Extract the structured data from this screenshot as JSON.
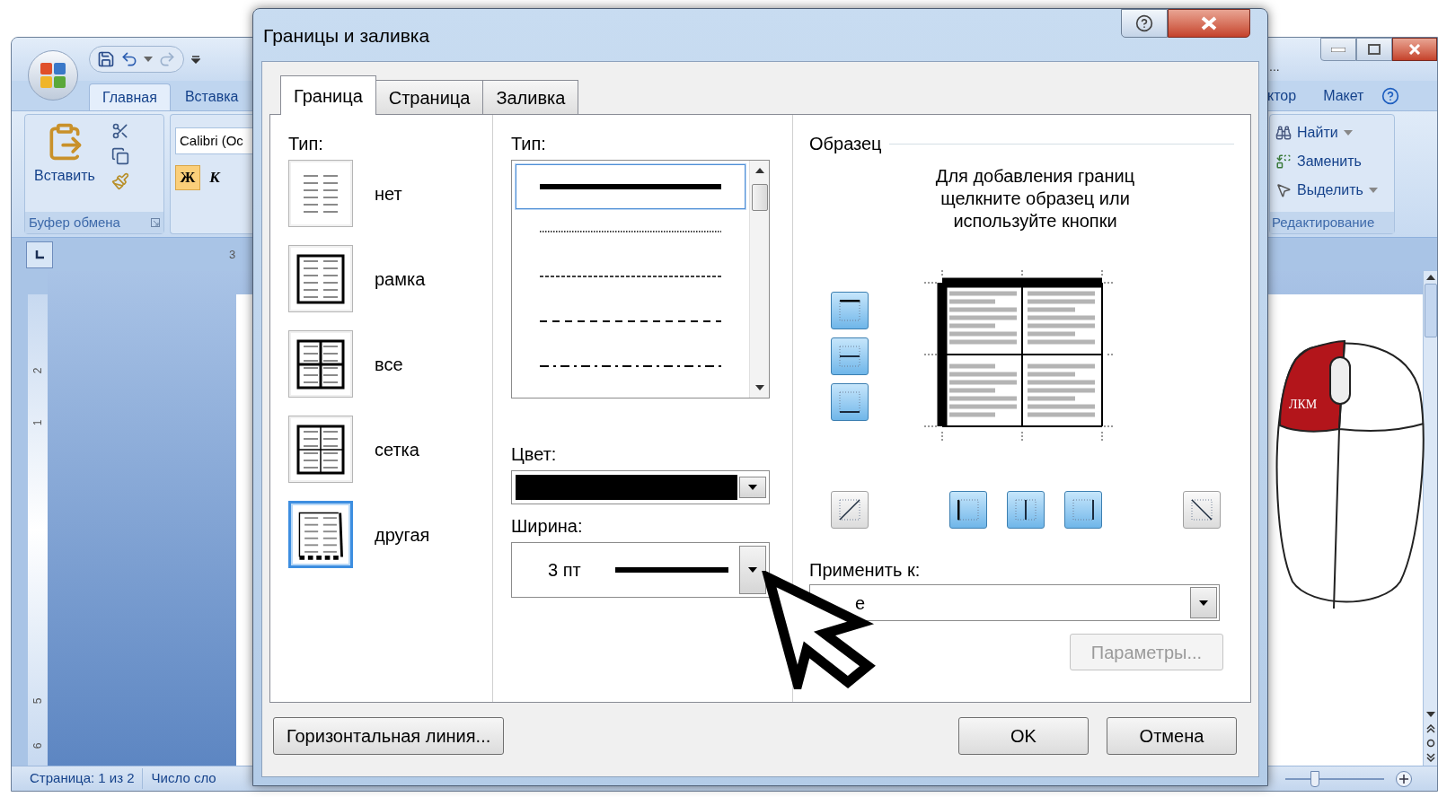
{
  "word": {
    "title_fragment": "...",
    "tabs": [
      {
        "label": "Главная",
        "selected": true
      },
      {
        "label": "Вставка",
        "selected": false
      }
    ],
    "right_tabs": [
      {
        "label": "ктор",
        "selected": false
      },
      {
        "label": "Макет",
        "selected": false
      }
    ],
    "clipboard": {
      "paste": "Вставить",
      "group": "Буфер обмена"
    },
    "font": {
      "name": "Calibri (Ос",
      "bold": "Ж",
      "italic": "К",
      "bold_active": true
    },
    "editing": {
      "items": [
        {
          "kind": "find",
          "label": "Найти",
          "dropdown": true
        },
        {
          "kind": "replace",
          "label": "Заменить",
          "dropdown": false
        },
        {
          "kind": "select",
          "label": "Выделить",
          "dropdown": true
        }
      ],
      "group": "Редактирование"
    },
    "ruler_fragment": "3",
    "vruler": [
      "2",
      "1",
      "5",
      "6"
    ],
    "status": [
      "Страница: 1 из 2",
      "Число сло"
    ],
    "zoom": {
      "level": 0.3
    }
  },
  "dialog": {
    "title": "Границы и заливка",
    "tabs": [
      {
        "label": "Граница",
        "selected": true
      },
      {
        "label": "Страница",
        "selected": false
      },
      {
        "label": "Заливка",
        "selected": false
      }
    ],
    "setting": {
      "label": "Тип:",
      "items": [
        {
          "kind": "none",
          "label": "нет",
          "selected": false
        },
        {
          "kind": "box",
          "label": "рамка",
          "selected": false
        },
        {
          "kind": "all",
          "label": "все",
          "selected": false
        },
        {
          "kind": "grid",
          "label": "сетка",
          "selected": false
        },
        {
          "kind": "custom",
          "label": "другая",
          "selected": true
        }
      ]
    },
    "style": {
      "label": "Тип:",
      "items": [
        {
          "kind": "solid",
          "selected": true
        },
        {
          "kind": "dotted",
          "selected": false
        },
        {
          "kind": "dashed-small",
          "selected": false
        },
        {
          "kind": "dashed",
          "selected": false
        },
        {
          "kind": "dash-dot",
          "selected": false
        }
      ]
    },
    "color": {
      "label": "Цвет:"
    },
    "width": {
      "label": "Ширина:",
      "value": "3 пт"
    },
    "preview": {
      "label": "Образец",
      "hint": "Для добавления границ\nщелкните образец или\nиспользуйте кнопки",
      "buttons": [
        {
          "kind": "top",
          "on": true,
          "thick": true
        },
        {
          "kind": "inside-h",
          "on": true,
          "thick": false
        },
        {
          "kind": "bottom",
          "on": true,
          "thick": false
        },
        {
          "kind": "diag-up",
          "on": false
        },
        {
          "kind": "left",
          "on": true,
          "thick": true
        },
        {
          "kind": "inside-v",
          "on": true,
          "thick": false
        },
        {
          "kind": "right",
          "on": true,
          "thick": false
        },
        {
          "kind": "diag-down",
          "on": false
        }
      ]
    },
    "apply": {
      "label": "Применить к:",
      "value": "е"
    },
    "options": {
      "label": "Параметры...",
      "disabled": true
    },
    "footer": {
      "horizontal_line": "Горизонтальная линия...",
      "ok": "OK",
      "cancel": "Отмена"
    }
  },
  "mouse": {
    "label": "ЛКМ"
  }
}
